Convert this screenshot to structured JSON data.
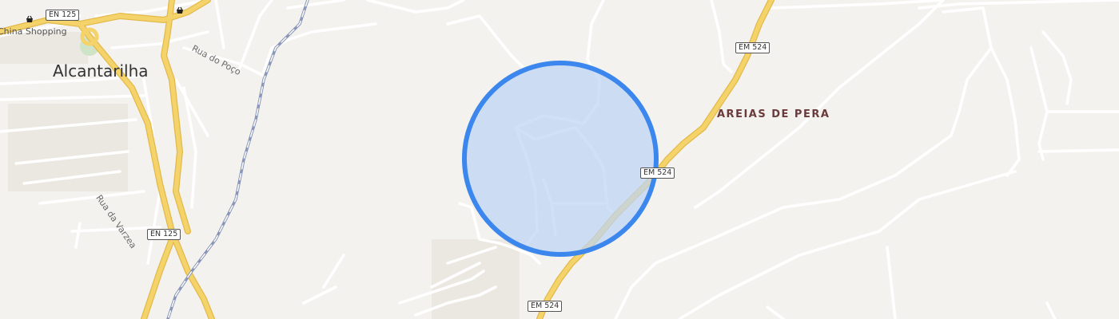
{
  "map": {
    "town": "Alcantarilha",
    "locality": "AREIAS DE PERA",
    "streets": {
      "rua_do_poco": "Rua do Poço",
      "rua_da_varzea": "Rua da Varzea"
    },
    "poi": {
      "shop_icon": "basket-icon",
      "china_shopping": "China Shopping"
    },
    "road_shields": {
      "en125_top": "EN 125",
      "en125_bottom": "EN 125",
      "em524_top": "EM 524",
      "em524_middle": "EM 524",
      "em524_bottom": "EM 524"
    },
    "colors": {
      "background": "#f4f2ee",
      "minor_road": "#ffffff",
      "major_road": "#f5d36b",
      "railway": "#8a96b8",
      "accuracy_circle_fill": "#bcd4f5",
      "accuracy_circle_stroke": "#3b87ee"
    }
  }
}
